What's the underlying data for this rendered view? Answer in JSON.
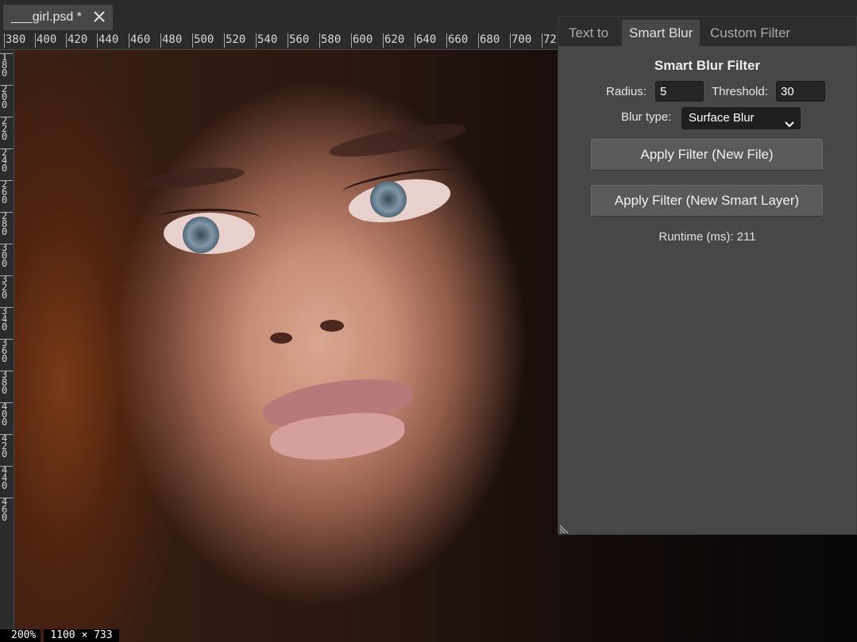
{
  "document_tab": {
    "title": "___girl.psd *"
  },
  "ruler": {
    "horizontal_labels": [
      "380",
      "400",
      "420",
      "440",
      "460",
      "480",
      "500",
      "520",
      "540",
      "560",
      "580",
      "600",
      "620",
      "640",
      "660",
      "680",
      "700",
      "72"
    ],
    "vertical_labels": [
      "180",
      "200",
      "220",
      "240",
      "260",
      "280",
      "300",
      "320",
      "340",
      "360",
      "380",
      "400",
      "420",
      "440",
      "460"
    ]
  },
  "status": {
    "zoom": "200%",
    "dimensions": "1100 × 733"
  },
  "panel": {
    "tabs": [
      {
        "label": "Text to",
        "active": false
      },
      {
        "label": "Smart Blur",
        "active": true
      },
      {
        "label": "Custom Filter",
        "active": false
      }
    ],
    "title": "Smart Blur Filter",
    "radius_label": "Radius:",
    "radius_value": "5",
    "threshold_label": "Threshold:",
    "threshold_value": "30",
    "blur_type_label": "Blur type:",
    "blur_type_value": "Surface Blur",
    "apply_new_file_label": "Apply Filter (New File)",
    "apply_smart_layer_label": "Apply Filter (New Smart Layer)",
    "runtime_text": "Runtime (ms): 211"
  },
  "icons": {
    "close": "close-icon",
    "dropdown": "chevron-down-icon",
    "resize": "resize-grip-icon"
  }
}
